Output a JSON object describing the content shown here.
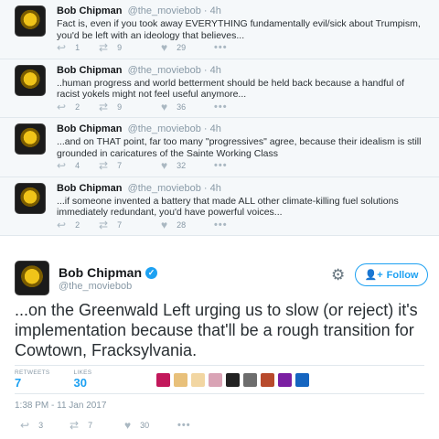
{
  "replies": [
    {
      "name": "Bob Chipman",
      "meta": "@the_moviebob · 4h",
      "text": "Fact is, even if you took away EVERYTHING fundamentally evil/sick about Trumpism, you'd be left with an ideology that believes...",
      "replies_count": "1",
      "retweets": "9",
      "likes": "29"
    },
    {
      "name": "Bob Chipman",
      "meta": "@the_moviebob · 4h",
      "text": "..human progress and world betterment should be held back because a handful of racist yokels might not feel useful anymore...",
      "replies_count": "2",
      "retweets": "9",
      "likes": "36"
    },
    {
      "name": "Bob Chipman",
      "meta": "@the_moviebob · 4h",
      "text": "...and on THAT point, far too many \"progressives\" agree, because their idealism is still grounded in caricatures of the Sainte Working Class",
      "replies_count": "4",
      "retweets": "7",
      "likes": "32"
    },
    {
      "name": "Bob Chipman",
      "meta": "@the_moviebob · 4h",
      "text": "...if someone invented a battery that made ALL other climate-killing fuel solutions immediately redundant, you'd have powerful voices...",
      "replies_count": "2",
      "retweets": "7",
      "likes": "28"
    }
  ],
  "main": {
    "name": "Bob Chipman",
    "handle": "@the_moviebob",
    "follow_label": "Follow",
    "text": "...on the Greenwald Left urging us to slow (or reject) it's implementation because that'll be a rough transition for Cowtown, Fracksylvania.",
    "retweets_label": "RETWEETS",
    "retweets": "7",
    "likes_label": "LIKES",
    "likes": "30",
    "timestamp": "1:38 PM - 11 Jan 2017",
    "replies_count": "3",
    "retweets_count": "7",
    "likes_count": "30"
  },
  "icons": {
    "reply": "reply-arrow-icon",
    "retweet": "retweet-icon",
    "like": "heart-icon",
    "more": "more-dots-icon",
    "settings": "gear-icon",
    "follow": "add-person-icon",
    "verified": "verified-badge-icon"
  },
  "colors": {
    "accent": "#1da1f2",
    "muted": "#8899a6",
    "thread_bg": "#f5f8fa"
  }
}
